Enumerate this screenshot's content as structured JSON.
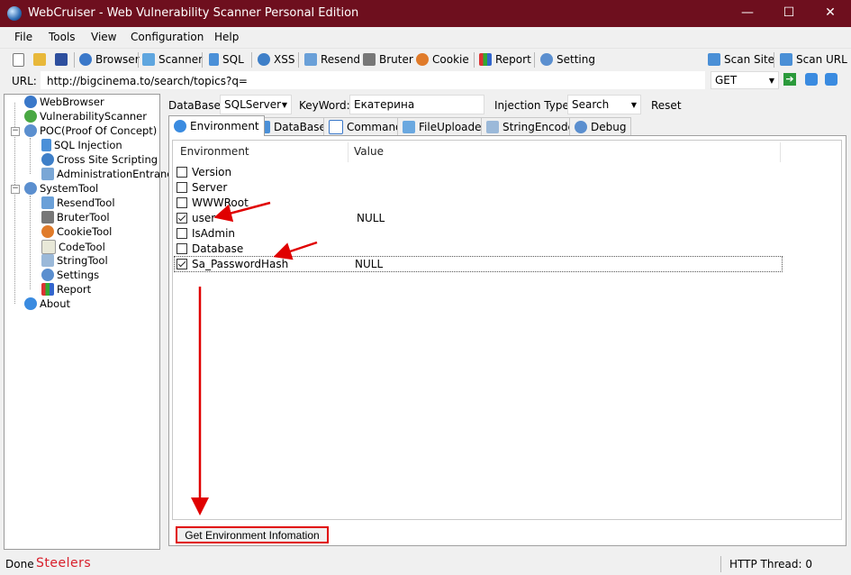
{
  "window": {
    "title": "WebCruiser - Web Vulnerability Scanner Personal Edition",
    "minimize": "—",
    "maximize": "☐",
    "close": "✕"
  },
  "menu": [
    "File",
    "Tools",
    "View",
    "Configuration",
    "Help"
  ],
  "toolbar": {
    "browser": "Browser",
    "scanner": "Scanner",
    "sql": "SQL",
    "xss": "XSS",
    "resend": "Resend",
    "bruter": "Bruter",
    "cookie": "Cookie",
    "report": "Report",
    "setting": "Setting",
    "scan_site": "Scan Site",
    "scan_url": "Scan URL"
  },
  "url_bar": {
    "label": "URL:",
    "value": "http://bigcinema.to/search/topics?q=",
    "method": "GET"
  },
  "sidebar": {
    "web_browser": "WebBrowser",
    "vulnerability_scanner": "VulnerabilityScanner",
    "poc": "POC(Proof Of Concept)",
    "sql_injection": "SQL Injection",
    "xss": "Cross Site Scripting",
    "admin_entrance": "AdministrationEntrance",
    "system_tool": "SystemTool",
    "resend_tool": "ResendTool",
    "bruter_tool": "BruterTool",
    "cookie_tool": "CookieTool",
    "code_tool": "CodeTool",
    "string_tool": "StringTool",
    "settings": "Settings",
    "report": "Report",
    "about": "About"
  },
  "filters": {
    "database_label": "DataBase:",
    "database_value": "SQLServer",
    "keyword_label": "KeyWord:",
    "keyword_value": "Екатерина",
    "injection_type_label": "Injection Type:",
    "injection_type_value": "Search",
    "reset": "Reset"
  },
  "tabs": [
    "Environment",
    "DataBase",
    "Command",
    "FileUploader",
    "StringEncode",
    "Debug"
  ],
  "env_table": {
    "col_environment": "Environment",
    "col_value": "Value",
    "rows": [
      {
        "name": "Version",
        "checked": false,
        "value": ""
      },
      {
        "name": "Server",
        "checked": false,
        "value": ""
      },
      {
        "name": "WWWRoot",
        "checked": false,
        "value": ""
      },
      {
        "name": "user",
        "checked": true,
        "value": "NULL"
      },
      {
        "name": "IsAdmin",
        "checked": false,
        "value": ""
      },
      {
        "name": "Database",
        "checked": false,
        "value": ""
      },
      {
        "name": "Sa_PasswordHash",
        "checked": true,
        "value": "NULL"
      }
    ]
  },
  "get_env_button": "Get Environment Infomation",
  "status": {
    "done": "Done",
    "watermark": "Steelers",
    "thread": "HTTP Thread: 0"
  }
}
